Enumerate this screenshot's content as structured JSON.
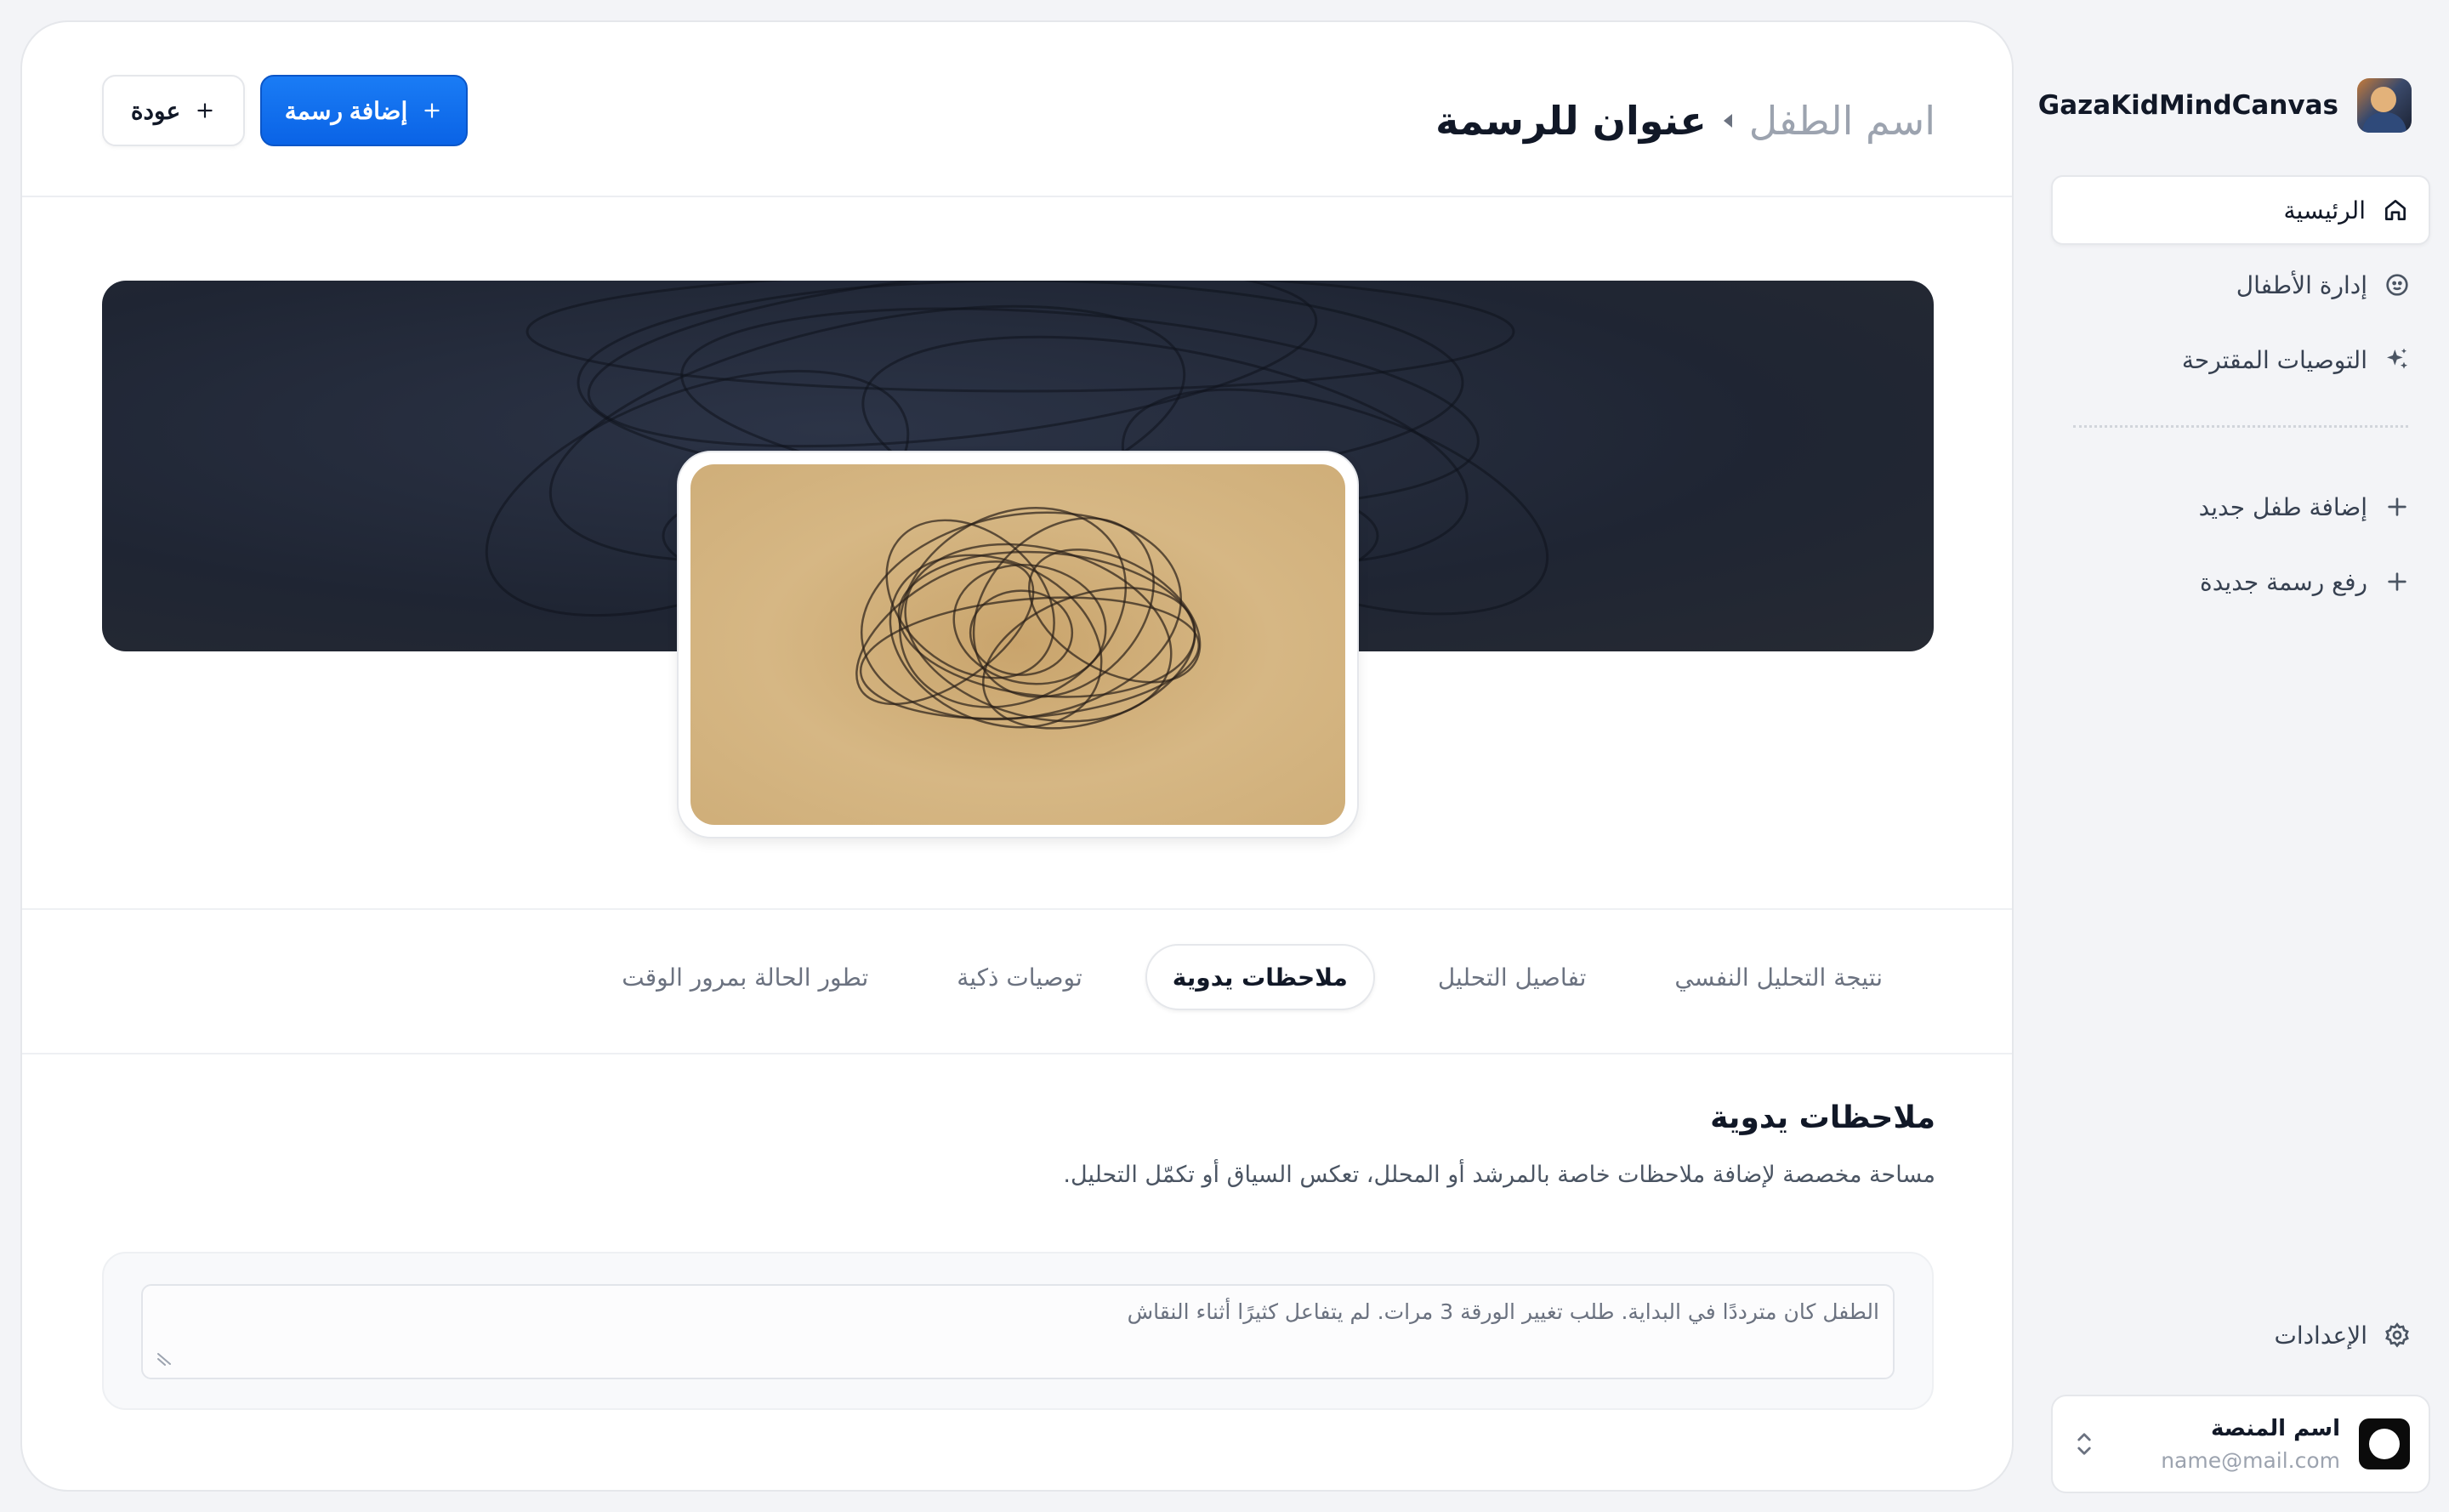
{
  "sidebar": {
    "brand_name": "GazaKidMindCanvas",
    "nav": [
      {
        "label": "الرئيسية",
        "icon": "home-icon",
        "active": true
      },
      {
        "label": "إدارة الأطفال",
        "icon": "smile-icon",
        "active": false
      },
      {
        "label": "التوصيات المقترحة",
        "icon": "sparkles-icon",
        "active": false
      }
    ],
    "actions": [
      {
        "label": "إضافة طفل جديد",
        "icon": "plus-icon"
      },
      {
        "label": "رفع رسمة جديدة",
        "icon": "plus-icon"
      }
    ],
    "settings_label": "الإعدادات",
    "account": {
      "name": "اسم المنصة",
      "email": "name@mail.com"
    }
  },
  "header": {
    "breadcrumb_child": "اسم الطفل",
    "title": "عنوان للرسمة",
    "add_button": "إضافة رسمة",
    "back_button": "عودة"
  },
  "tabs": [
    {
      "label": "نتيجة التحليل النفسي",
      "active": false
    },
    {
      "label": "تفاصيل التحليل",
      "active": false
    },
    {
      "label": "ملاحظات يدوية",
      "active": true
    },
    {
      "label": "توصيات ذكية",
      "active": false
    },
    {
      "label": "تطور الحالة بمرور الوقت",
      "active": false
    }
  ],
  "notes": {
    "title": "ملاحظات يدوية",
    "description": "مساحة مخصصة لإضافة ملاحظات خاصة بالمرشد أو المحلل، تعكس السياق أو تكمّل التحليل.",
    "value": "الطفل كان مترددًا في البداية. طلب تغيير الورقة 3 مرات. لم يتفاعل كثيرًا أثناء النقاش"
  },
  "colors": {
    "accent": "#0a63e6",
    "background": "#f3f4f7",
    "banner": "#1f2533",
    "paper": "#d6b784"
  }
}
